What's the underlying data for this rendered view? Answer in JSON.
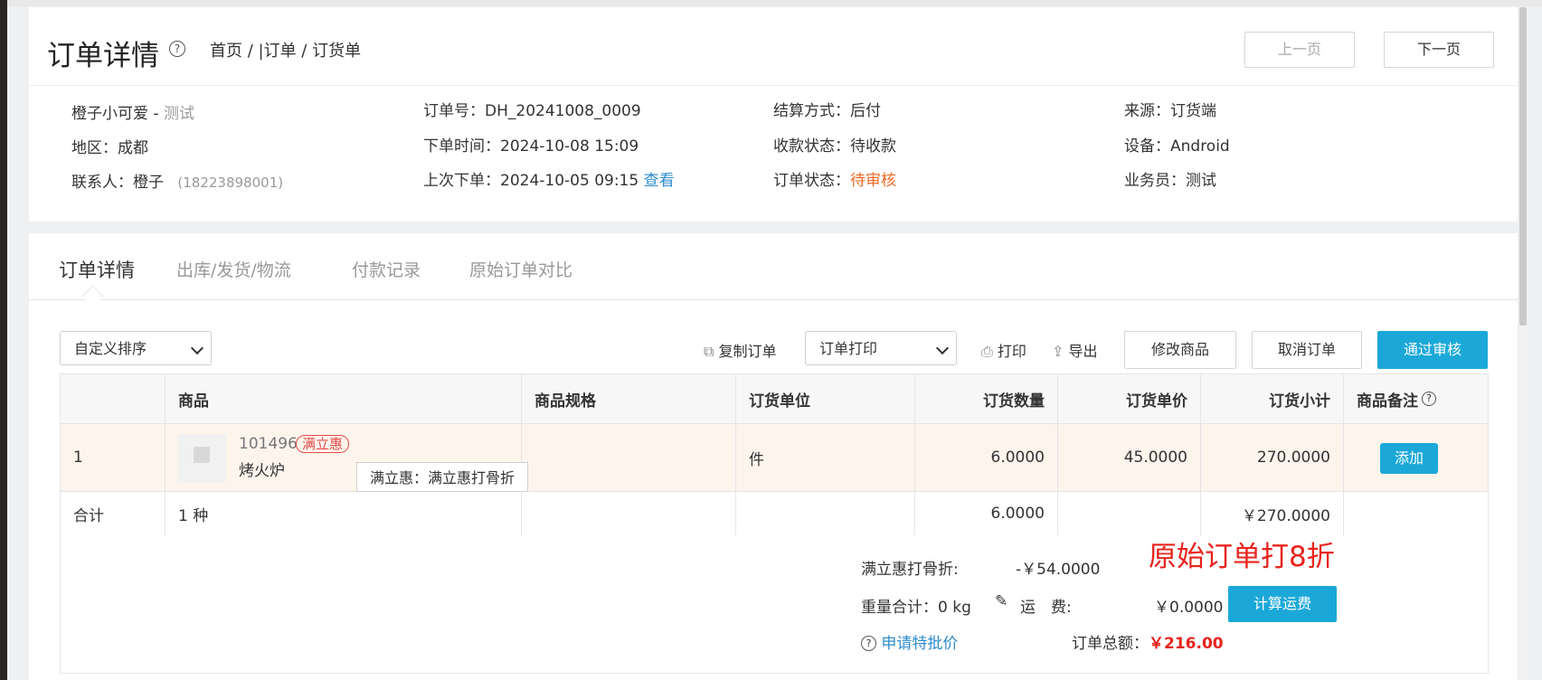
{
  "header": {
    "title": "订单详情",
    "breadcrumb": "首页 / |订单 / 订货单",
    "prev_label": "上一页",
    "next_label": "下一页"
  },
  "info": {
    "customer": "橙子小可爱",
    "customer_sep": " - ",
    "customer_tag": "测试",
    "region": "地区：成都",
    "contact": "联系人：橙子",
    "contact_phone": "(18223898001)",
    "order_no": "订单号：DH_20241008_0009",
    "order_time": "下单时间：2024-10-08 15:09",
    "last_order": "上次下单：2024-10-05 09:15",
    "last_order_link": "查看",
    "settle": "结算方式：后付",
    "pay_status": "收款状态：待收款",
    "order_status_label": "订单状态：",
    "order_status": "待审核",
    "source": "来源：订货端",
    "device": "设备：Android",
    "salesman": "业务员：测试"
  },
  "tabs": [
    "订单详情",
    "出库/发货/物流",
    "付款记录",
    "原始订单对比"
  ],
  "toolbar": {
    "sort_select": "自定义排序",
    "copy_order": "复制订单",
    "print_select": "订单打印",
    "print": "打印",
    "export": "导出",
    "edit_goods": "修改商品",
    "cancel_order": "取消订单",
    "approve": "通过审核"
  },
  "table": {
    "headers": [
      "",
      "商品",
      "商品规格",
      "订货单位",
      "订货数量",
      "订货单价",
      "订货小计",
      "商品备注"
    ],
    "item": {
      "index": "1",
      "code": "101496",
      "badge": "满立惠",
      "name": "烤火炉",
      "spec": "",
      "unit": "件",
      "qty": "6.0000",
      "price": "45.0000",
      "subtotal": "270.0000",
      "add_label": "添加",
      "tooltip": "满立惠：满立惠打骨折"
    },
    "total": {
      "label": "合计",
      "kinds": "1 种",
      "qty": "6.0000",
      "subtotal": "￥270.0000"
    }
  },
  "summary": {
    "discount_label": "满立惠打骨折:",
    "discount_value": "-￥54.0000",
    "note": "原始订单打8折",
    "weight": "重量合计：0 kg",
    "freight_label": "运　费:",
    "freight_value": "￥0.0000",
    "calc_btn": "计算运费",
    "special_price": "申请特批价",
    "total_label": "订单总额：",
    "total_value": "￥216.00"
  }
}
